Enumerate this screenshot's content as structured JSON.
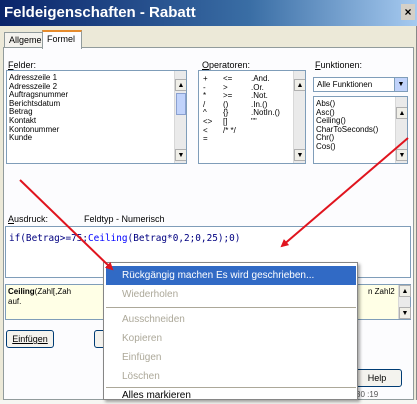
{
  "window": {
    "title": "Feldeigenschaften - Rabatt",
    "close_glyph": "×"
  },
  "tabs": [
    {
      "label": "Allgemein"
    },
    {
      "label": "Formel"
    }
  ],
  "fields": {
    "label": "Felder:",
    "items": [
      "Adresszeile 1",
      "Adresszeile 2",
      "Auftragsnummer",
      "Berichtsdatum",
      "Betrag",
      "Kontakt",
      "Kontonummer",
      "Kunde"
    ]
  },
  "operators": {
    "label": "Operatoren:",
    "col1": [
      "+",
      "-",
      "*",
      "/",
      "^",
      "<>",
      "<"
    ],
    "col2": [
      "<=",
      ">",
      ">=",
      "()",
      "{}",
      "[]",
      "/* */"
    ],
    "col3": [
      ".And.",
      ".Or.",
      ".Not.",
      ".In.()",
      ".NotIn.()",
      "\"\"",
      ""
    ],
    "extra_symbol": "="
  },
  "functions": {
    "label": "Funktionen:",
    "selected": "Alle Funktionen",
    "items": [
      "Abs()",
      "Asc()",
      "Ceiling()",
      "CharToSeconds()",
      "Chr()",
      "Cos()"
    ]
  },
  "expression": {
    "label": "Ausdruck:",
    "type_label": "Feldtyp - Numerisch",
    "part1": "if(Betrag>=75;",
    "fn_name": "Ceiling",
    "part2": "(Betrag*0,2;0,25);0)"
  },
  "description": {
    "func_name": "Ceiling",
    "line1_rest": "(Zahl[,Zah",
    "line1_tail": "n Zahl2",
    "line2": "auf."
  },
  "buttons": {
    "insert": "Einfügen",
    "help": "Help"
  },
  "context_menu": {
    "items": [
      {
        "label": "Rückgängig machen Es wird geschrieben...",
        "enabled": true,
        "highlighted": true
      },
      {
        "label": "Wiederholen",
        "enabled": false
      },
      {
        "label": "Ausschneiden",
        "enabled": false
      },
      {
        "label": "Kopieren",
        "enabled": false
      },
      {
        "label": "Einfügen",
        "enabled": false
      },
      {
        "label": "Löschen",
        "enabled": false
      },
      {
        "label": "Alles markieren",
        "enabled": true
      }
    ]
  },
  "colors": {
    "arrow": "#e0141e",
    "title_start": "#0a246a",
    "menu_highlight": "#316ac5"
  },
  "footer_partial": "30 :19"
}
